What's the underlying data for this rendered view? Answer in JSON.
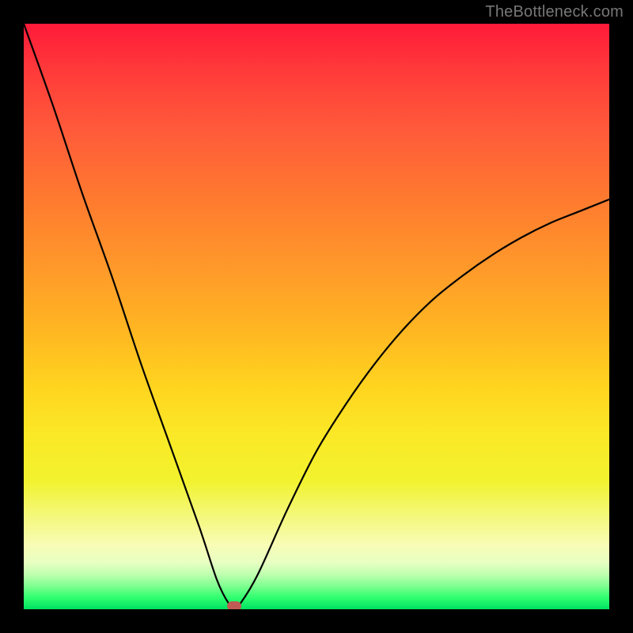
{
  "watermark": "TheBottleneck.com",
  "chart_data": {
    "type": "line",
    "title": "",
    "xlabel": "",
    "ylabel": "",
    "xlim": [
      0,
      100
    ],
    "ylim": [
      0,
      100
    ],
    "grid": false,
    "legend": false,
    "series": [
      {
        "name": "bottleneck-curve",
        "x": [
          0,
          5,
          10,
          15,
          20,
          25,
          30,
          33,
          35,
          36,
          37,
          40,
          45,
          50,
          55,
          60,
          65,
          70,
          75,
          80,
          85,
          90,
          95,
          100
        ],
        "values": [
          100,
          86,
          71,
          57,
          42,
          28,
          14,
          5,
          1,
          0.5,
          1,
          6,
          17,
          27,
          35,
          42,
          48,
          53,
          57,
          60.5,
          63.5,
          66,
          68,
          70
        ]
      }
    ],
    "marker": {
      "x": 36,
      "y": 0.5
    },
    "background_gradient": {
      "top": "#ff1a3a",
      "mid": "#ffd41f",
      "bottom": "#00e060"
    }
  }
}
